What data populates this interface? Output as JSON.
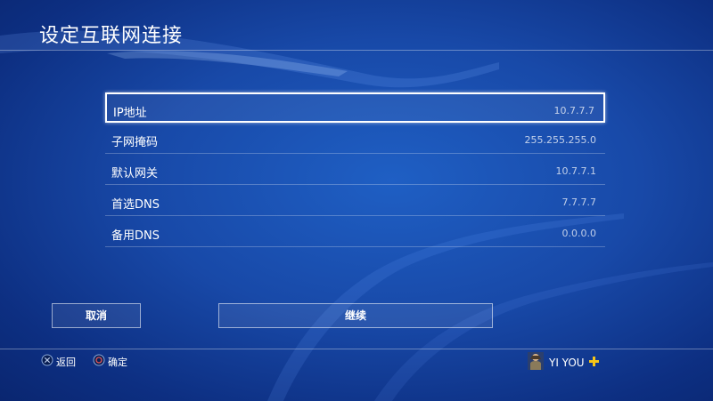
{
  "screen": {
    "title": "设定互联网连接"
  },
  "fields": [
    {
      "label": "IP地址",
      "value": "10.7.7.7",
      "selected": true
    },
    {
      "label": "子网掩码",
      "value": "255.255.255.0",
      "selected": false
    },
    {
      "label": "默认网关",
      "value": "10.7.7.1",
      "selected": false
    },
    {
      "label": "首选DNS",
      "value": "7.7.7.7",
      "selected": false
    },
    {
      "label": "备用DNS",
      "value": "0.0.0.0",
      "selected": false
    }
  ],
  "buttons": {
    "cancel_label": "取消",
    "continue_label": "继续"
  },
  "hints": {
    "back_label": "返回",
    "confirm_label": "确定",
    "back_icon": "cross-button-icon",
    "confirm_icon": "circle-button-icon"
  },
  "user": {
    "name": "YI YOU",
    "plus_icon": "playstation-plus-icon",
    "plus_color": "#f5c518"
  },
  "colors": {
    "background": "#1849a8",
    "accent": "#ffffff"
  }
}
